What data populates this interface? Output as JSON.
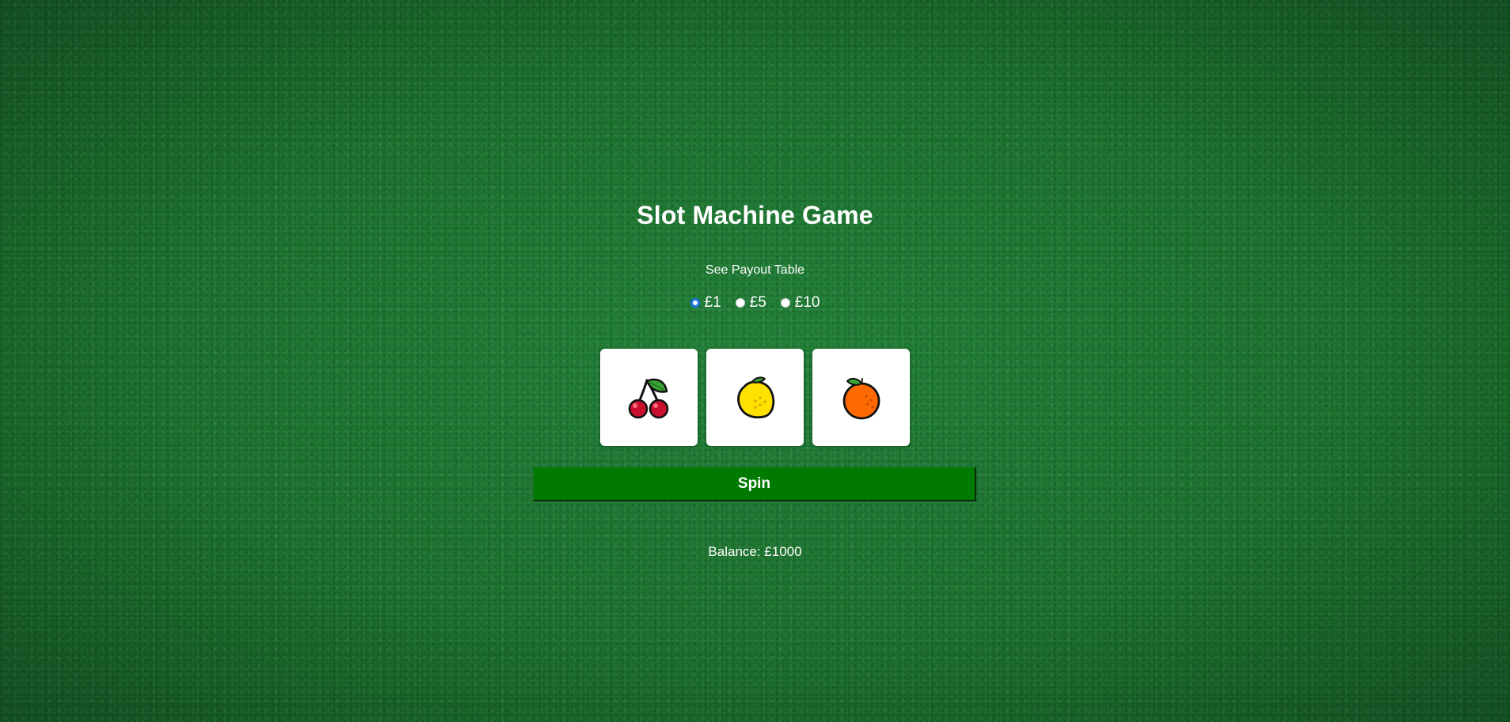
{
  "app": {
    "title": "Slot Machine Game",
    "payout_link": "See Payout Table",
    "background_color": "#1f7a30"
  },
  "bets": [
    {
      "label": "£1",
      "selected": true
    },
    {
      "label": "£5",
      "selected": false
    },
    {
      "label": "£10",
      "selected": false
    }
  ],
  "reels": [
    {
      "symbol": "cherry-icon"
    },
    {
      "symbol": "lemon-icon"
    },
    {
      "symbol": "orange-icon"
    }
  ],
  "spin": {
    "label": "Spin",
    "color": "#007a00"
  },
  "balance": {
    "text": "Balance: £1000"
  }
}
